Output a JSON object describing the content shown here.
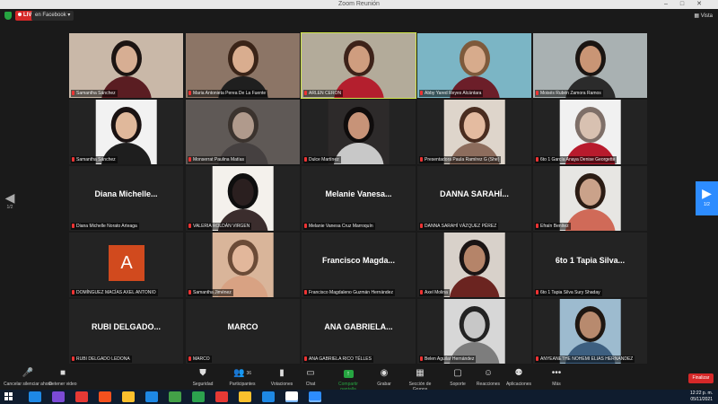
{
  "window": {
    "title": "Zoom Reunión"
  },
  "topbar": {
    "live": "LIVE",
    "platform": "en Facebook",
    "view": "Vista"
  },
  "pager": {
    "left": "1/2",
    "right": "1/2"
  },
  "tiles": [
    {
      "kind": "video",
      "label": "Samantha Sánchez",
      "bg": "#c9b8a8",
      "skin": "#d7ae93",
      "hair": "#1c1412",
      "shirt": "#5a1d22"
    },
    {
      "kind": "video",
      "label": "Maria Antonieta Perea De La Fuente",
      "bg": "#8c7566",
      "skin": "#d9ad8f",
      "hair": "#3a2418",
      "shirt": "#1f1f1f"
    },
    {
      "kind": "video",
      "label": "ARLEN CERON",
      "bg": "#b3ab9a",
      "skin": "#cf9d7f",
      "hair": "#3d2219",
      "shirt": "#b41f2e",
      "active": true
    },
    {
      "kind": "video",
      "label": "Abby Yared Reyes Alcántara",
      "bg": "#7bb5c5",
      "skin": "#d7ab8c",
      "hair": "#7e5a3c",
      "shirt": "#6c1e29"
    },
    {
      "kind": "video",
      "label": "Moisés Rubén Zamora Ramos",
      "bg": "#a9b1b2",
      "skin": "#c99575",
      "hair": "#1b1512",
      "shirt": "#2b2b2b"
    },
    {
      "kind": "narrow",
      "label": "Samantha Sánchez",
      "bg": "#f2f2f2",
      "skin": "#e0b89b",
      "hair": "#1a1212",
      "shirt": "#1e1e1e"
    },
    {
      "kind": "video",
      "label": "Monserrat Paulina Matías",
      "bg": "#5f5956",
      "skin": "#b09a8c",
      "hair": "#3b332e",
      "shirt": "#454040"
    },
    {
      "kind": "narrow",
      "label": "Dulce Martínez",
      "bg": "#2d2a2a",
      "skin": "#c79378",
      "hair": "#0f0c0c",
      "shirt": "#c8c8c8"
    },
    {
      "kind": "narrow",
      "label": "Presentadora Paula Ramírez G (She)",
      "bg": "#ded5cb",
      "skin": "#e4bba0",
      "hair": "#4a2d20",
      "shirt": "#8d6d5d"
    },
    {
      "kind": "narrow",
      "label": "6to 1 García Anaya Denise Georgette",
      "bg": "#f1f1f1",
      "skin": "#d8c1b1",
      "hair": "#7e6f68",
      "shirt": "#b81b2d"
    },
    {
      "kind": "name",
      "label": "Diana Michelle Norato Arteaga",
      "name": "Diana Michelle..."
    },
    {
      "kind": "narrow",
      "label": "VALERIA ROLDÁN VIRGEN",
      "bg": "#f4f1ec",
      "skin": "#2a1f1f",
      "hair": "#0e0e0e",
      "shirt": "#3b2d2d"
    },
    {
      "kind": "name",
      "label": "Melanie Vanesa Cruz Marroquín",
      "name": "Melanie Vanesa..."
    },
    {
      "kind": "name",
      "label": "DANNA SARAHÍ VÁZQUEZ PÉREZ",
      "name": "DANNA SARAHÍ..."
    },
    {
      "kind": "narrow",
      "label": "Efraín Benítez",
      "bg": "#e7e6e3",
      "skin": "#caa28a",
      "hair": "#2b1c14",
      "shirt": "#d06a58"
    },
    {
      "kind": "letter",
      "label": "DOMÍNGUEZ MACÍAS AXEL ANTONIO",
      "letter": "A"
    },
    {
      "kind": "narrow",
      "label": "Samantha Jiménez",
      "bg": "#d9b59a",
      "skin": "#e2b79b",
      "hair": "#6b4b37",
      "shirt": "#d8a283"
    },
    {
      "kind": "name",
      "label": "Francisco Magdaleno Guzmán Hernández",
      "name": "Francisco Magda..."
    },
    {
      "kind": "narrow",
      "label": "Axel Molina",
      "bg": "#d8d1ca",
      "skin": "#b58469",
      "hair": "#1a1414",
      "shirt": "#6b2420"
    },
    {
      "kind": "name",
      "label": "6to 1 Tapia Silva Sury Shaday",
      "name": "6to 1 Tapia Silva..."
    },
    {
      "kind": "name",
      "label": "RUBI DELGADO LEDONA",
      "name": "RUBI DELGADO..."
    },
    {
      "kind": "name",
      "label": "MARCO",
      "name": "MARCO"
    },
    {
      "kind": "name",
      "label": "ANA GABRIELA RICO TÉLLES",
      "name": "ANA GABRIELA..."
    },
    {
      "kind": "narrow",
      "label": "Belen Aguilar Hernández",
      "bg": "#d7d7d7",
      "skin": "#c7c7c7",
      "hair": "#232323",
      "shirt": "#7d7d7d"
    },
    {
      "kind": "narrow",
      "label": "ANYEANETHE NOHEMI ELIAS HERNANDEZ",
      "bg": "#9dbbcf",
      "skin": "#b88a6e",
      "hair": "#1f1712",
      "shirt": "#3d5f80"
    }
  ],
  "toolbar": {
    "items": [
      {
        "label": "Cancelar silenciar ahora",
        "icon": "🎤",
        "name": "unmute-button"
      },
      {
        "label": "Detener video",
        "icon": "■",
        "name": "stop-video-button"
      },
      {
        "label": "Seguridad",
        "icon": "⛊",
        "name": "security-button"
      },
      {
        "label": "Participantes",
        "icon": "👥",
        "name": "participants-button",
        "badge": "36"
      },
      {
        "label": "Votaciones",
        "icon": "▮",
        "name": "polls-button"
      },
      {
        "label": "Chat",
        "icon": "▭",
        "name": "chat-button"
      },
      {
        "label": "Compartir pantalla",
        "icon": "↑",
        "name": "share-screen-button"
      },
      {
        "label": "Grabar",
        "icon": "◉",
        "name": "record-button"
      },
      {
        "label": "Sección de Grupos",
        "icon": "▦",
        "name": "breakout-rooms-button"
      },
      {
        "label": "Soporte",
        "icon": "▢",
        "name": "support-button"
      },
      {
        "label": "Reacciones",
        "icon": "☺",
        "name": "reactions-button"
      },
      {
        "label": "Aplicaciones",
        "icon": "⚉",
        "name": "apps-button"
      },
      {
        "label": "Más",
        "icon": "•••",
        "name": "more-button"
      }
    ],
    "end": "Finalizar"
  },
  "taskbar": {
    "time": "12:22 p. m.",
    "date": "05/11/2021"
  }
}
